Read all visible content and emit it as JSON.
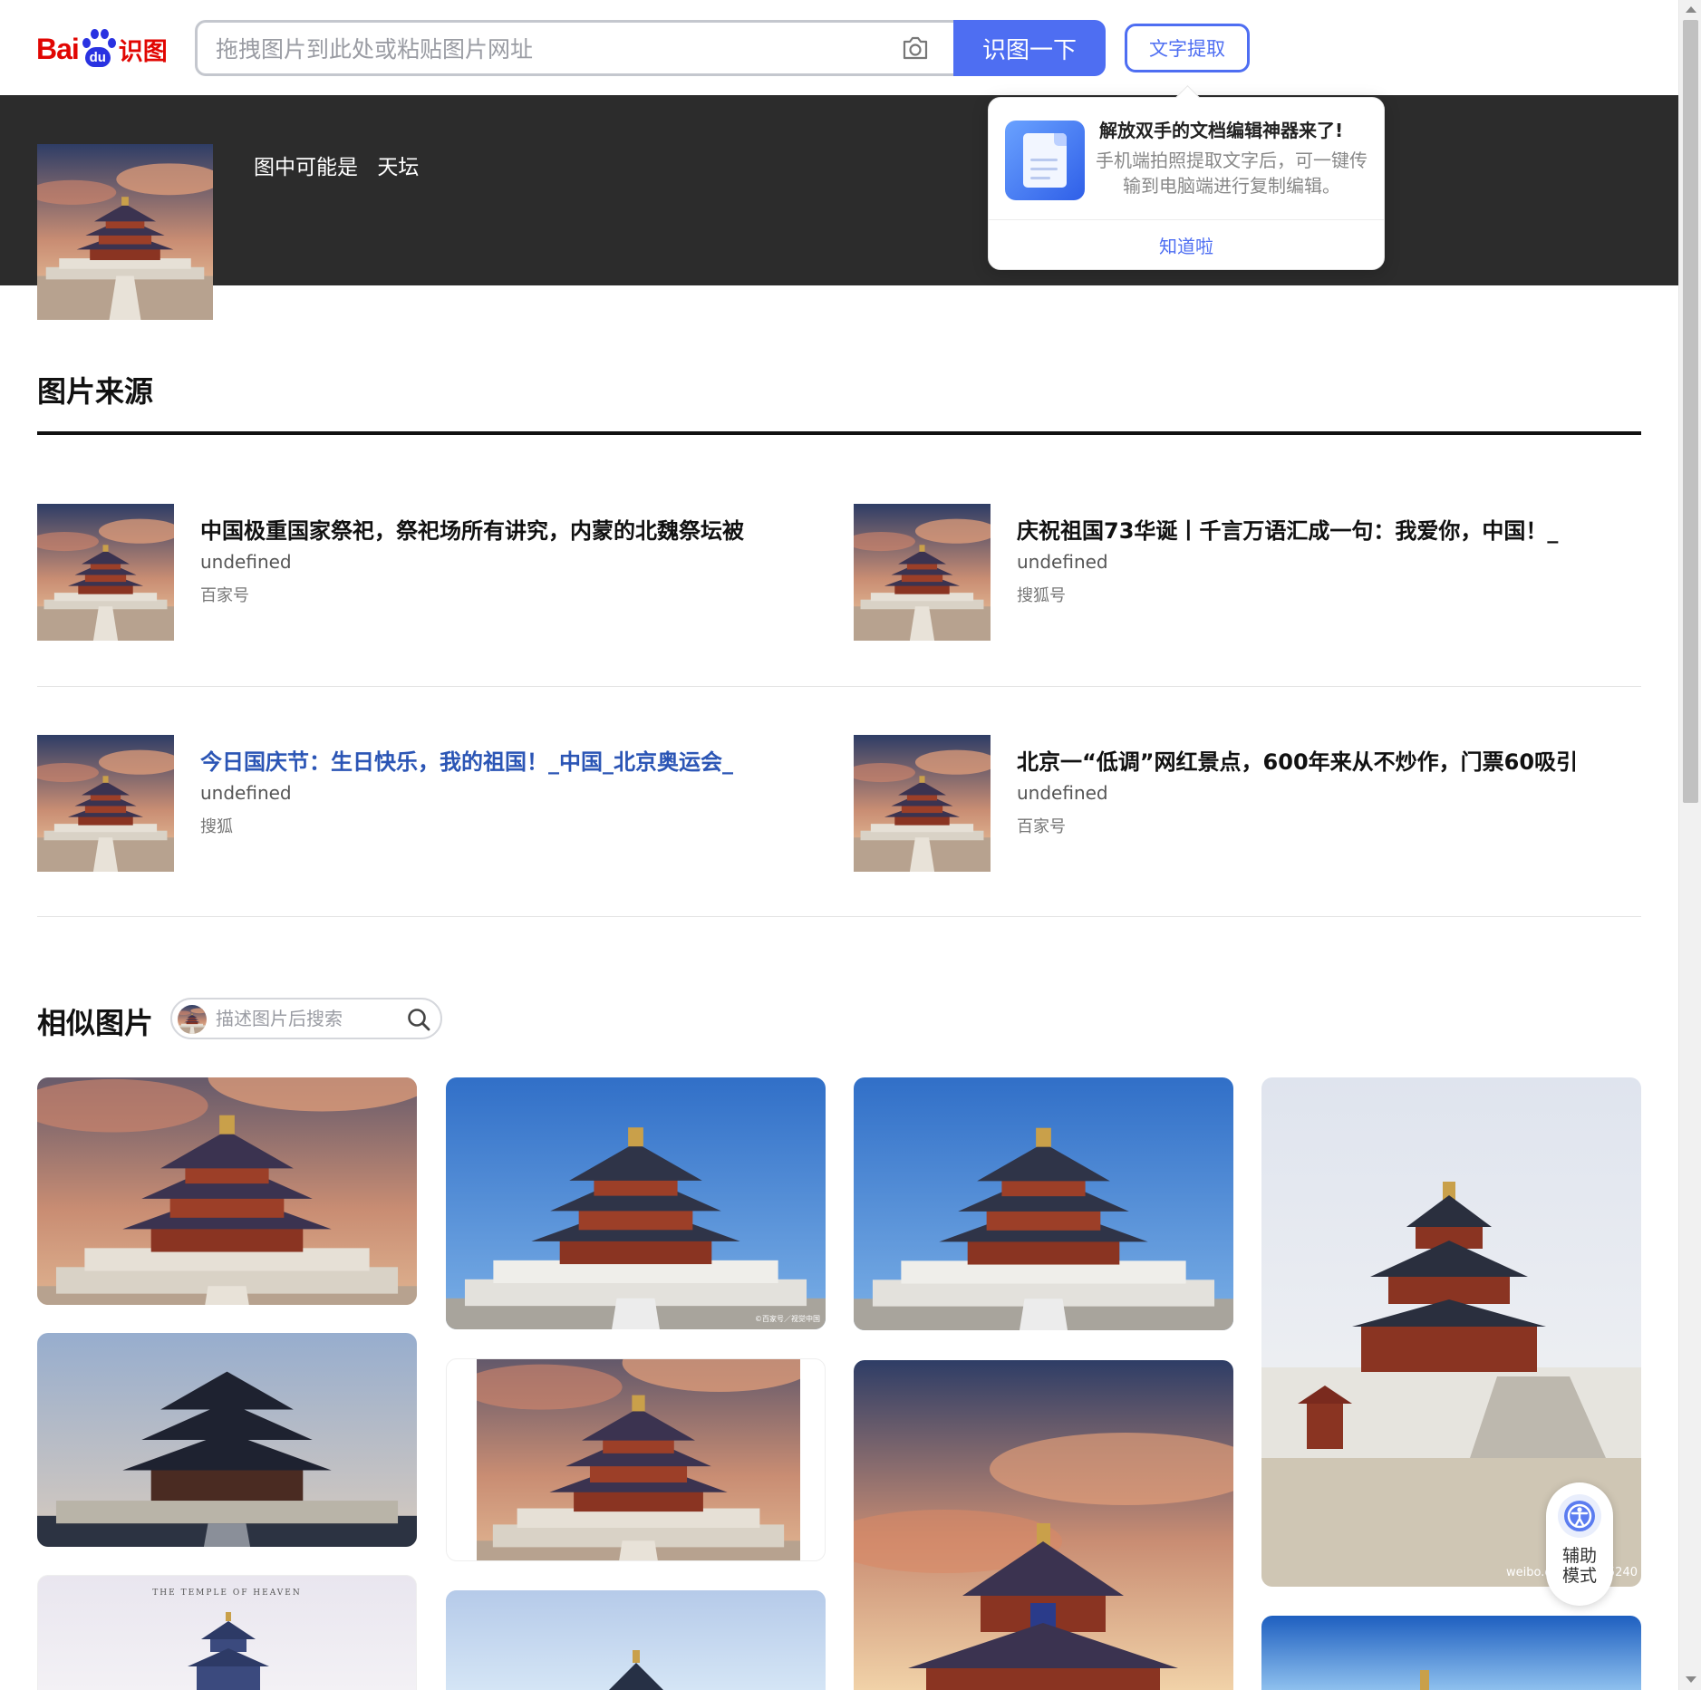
{
  "header": {
    "logo_text_bai": "Bai",
    "logo_text_du": "du",
    "logo_text_sub": "识图",
    "search_placeholder": "拖拽图片到此处或粘贴图片网址",
    "search_button": "识图一下",
    "ocr_button": "文字提取",
    "camera_icon": "camera-icon"
  },
  "result": {
    "guess_label": "图中可能是",
    "guess_value": "天坛"
  },
  "popup": {
    "title": "解放双手的文档编辑神器来了!",
    "body": "手机端拍照提取文字后，可一键传输到电脑端进行复制编辑。",
    "confirm": "知道啦",
    "icon": "document-icon"
  },
  "sources": {
    "heading": "图片来源",
    "items": [
      {
        "title": "中国极重国家祭祀，祭祀场所有讲究，内蒙的北魏祭坛被",
        "url": "undefined",
        "site": "百家号"
      },
      {
        "title": "庆祝祖国73华诞丨千言万语汇成一句：我爱你，中国！_",
        "url": "undefined",
        "site": "搜狐号"
      },
      {
        "title": "今日国庆节：生日快乐，我的祖国！_中国_北京奥运会_",
        "url": "undefined",
        "site": "搜狐"
      },
      {
        "title": "北京一“低调”网红景点，600年来从不炒作，门票60吸引",
        "url": "undefined",
        "site": "百家号"
      }
    ]
  },
  "similar": {
    "heading": "相似图片",
    "search_placeholder": "描述图片后搜索",
    "search_icon": "search-icon",
    "watermark_2": "©百家号／视觉中国",
    "poster_text": "THE TEMPLE OF HEAVEN",
    "watermark_8": "weibo.c",
    "watermark_8b": "5240"
  },
  "assist": {
    "label": "辅助模式",
    "icon": "accessibility-icon"
  },
  "colors": {
    "brand_blue": "#4e6ef2",
    "brand_red": "#e10602",
    "banner_bg": "#2c2c2c",
    "link_blue": "#2b55b5"
  }
}
